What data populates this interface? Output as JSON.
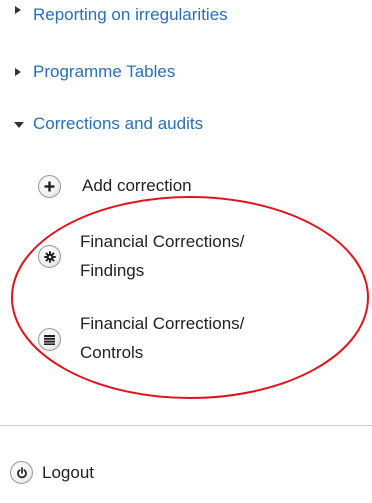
{
  "menu": {
    "items": [
      {
        "label": "Reporting on irregularities",
        "state": "collapsed"
      },
      {
        "label": "Programme Tables",
        "state": "collapsed"
      },
      {
        "label": "Corrections and audits",
        "state": "expanded"
      }
    ],
    "sub_items": [
      {
        "label": "Add correction",
        "icon": "plus-icon"
      },
      {
        "label_line1": "Financial Corrections/",
        "label_line2": "Findings",
        "icon": "gear-icon"
      },
      {
        "label_line1": "Financial Corrections/",
        "label_line2": "Controls",
        "icon": "list-icon"
      }
    ]
  },
  "logout": {
    "label": "Logout",
    "icon": "power-icon"
  },
  "annotation": {
    "color": "#e0141e",
    "shape": "ellipse"
  },
  "colors": {
    "link": "#2a6fb5",
    "text": "#222222",
    "divider": "#cccccc"
  }
}
